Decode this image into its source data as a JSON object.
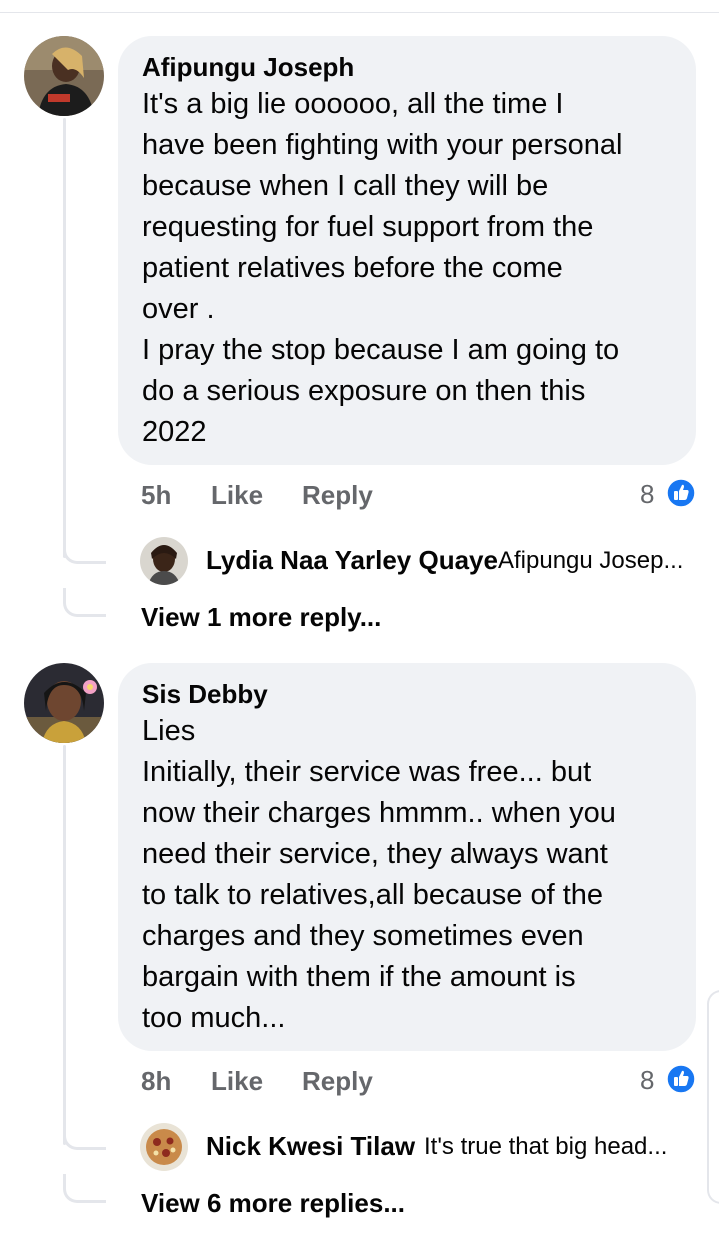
{
  "comments": [
    {
      "author": "Afipungu Joseph",
      "text": "It's a big lie oooooo, all the time I\nhave been fighting with your personal\nbecause when I call they will be\nrequesting for fuel support from the\npatient relatives before the come\nover .\nI pray the stop because I am going to\ndo a serious exposure on then this\n2022",
      "time": "5h",
      "like_label": "Like",
      "reply_label": "Reply",
      "reaction_count": "8",
      "reply_preview": {
        "author": "Lydia Naa Yarley Quaye",
        "snippet": "Afipungu Josep..."
      },
      "view_more": "View 1 more reply..."
    },
    {
      "author": "Sis Debby",
      "text": "Lies\nInitially, their service was free... but\nnow their charges hmmm.. when you\nneed their service, they always want\nto talk to relatives,all because of the\ncharges and they sometimes even\nbargain with them if the amount is\ntoo much...",
      "time": "8h",
      "like_label": "Like",
      "reply_label": "Reply",
      "reaction_count": "8",
      "reply_preview": {
        "author": "Nick Kwesi Tilaw",
        "snippet": "It's true that big head..."
      },
      "view_more": "View 6 more replies..."
    }
  ],
  "colors": {
    "bubble": "#f0f2f5",
    "meta": "#65676b",
    "like_blue": "#1877f2",
    "thread_line": "#e4e6eb"
  },
  "icons": [
    "like-reaction-icon",
    "avatar"
  ]
}
